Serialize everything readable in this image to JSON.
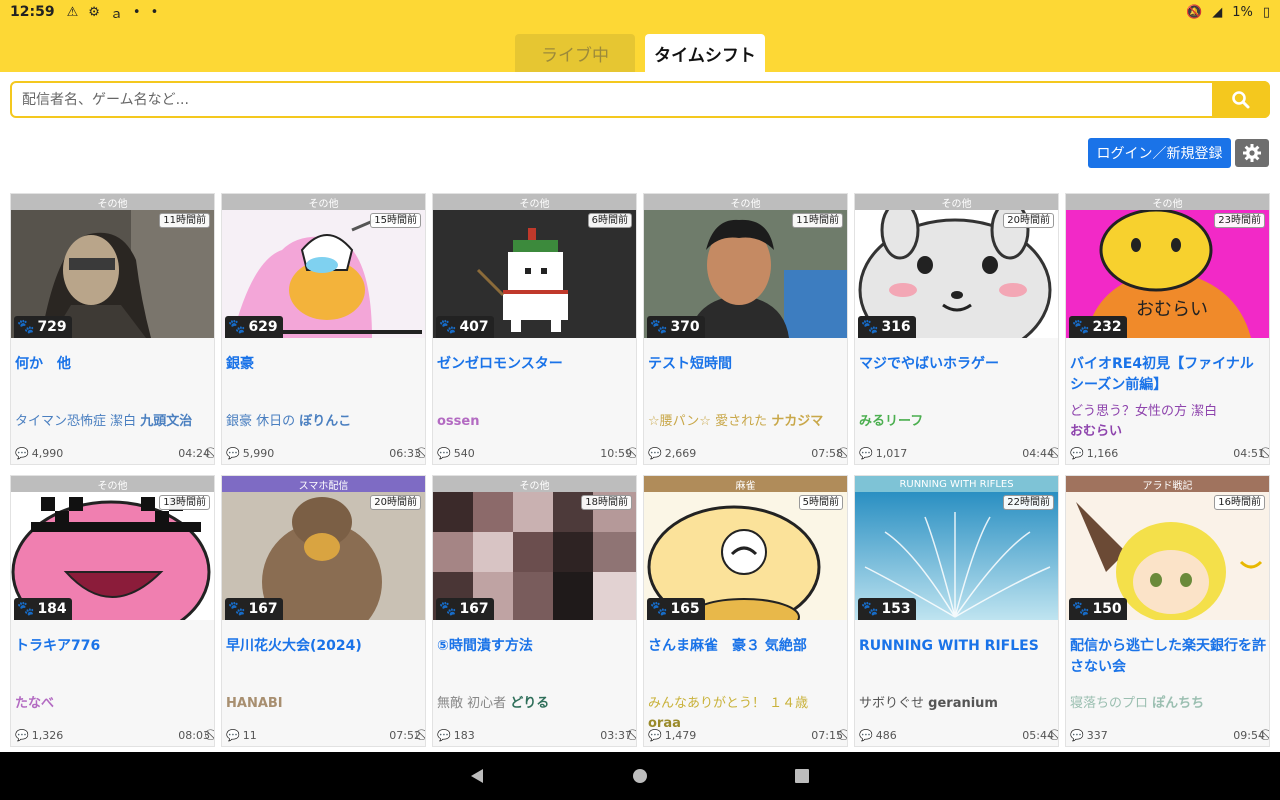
{
  "status": {
    "time": "12:59",
    "battery": "1%"
  },
  "tabs": {
    "live": "ライブ中",
    "timeshift": "タイムシフト"
  },
  "search": {
    "placeholder": "配信者名、ゲーム名など..."
  },
  "login_label": "ログイン／新規登録",
  "cards": [
    {
      "category": "その他",
      "cat_color": "#bdbdbd",
      "ago": "11時間前",
      "viewers": "729",
      "title": "何か　他",
      "sub": "タイマン恐怖症 潔白",
      "author": "九頭文治",
      "sub_color": "#4a7fc0",
      "comments": "4,990",
      "duration": "04:24"
    },
    {
      "category": "その他",
      "cat_color": "#bdbdbd",
      "ago": "15時間前",
      "viewers": "629",
      "title": "銀豪",
      "sub": "銀豪 休日の",
      "author": "ぼりんこ",
      "sub_color": "#4a7fc0",
      "comments": "5,990",
      "duration": "06:33"
    },
    {
      "category": "その他",
      "cat_color": "#bdbdbd",
      "ago": "6時間前",
      "viewers": "407",
      "title": "ゼンゼロモンスター",
      "sub": "",
      "author": "ossen",
      "sub_color": "#b36bc2",
      "comments": "540",
      "duration": "10:59"
    },
    {
      "category": "その他",
      "cat_color": "#bdbdbd",
      "ago": "11時間前",
      "viewers": "370",
      "title": "テスト短時間",
      "sub": "☆腰パン☆ 愛された",
      "author": "ナカジマ",
      "sub_color": "#c9a84a",
      "comments": "2,669",
      "duration": "07:58"
    },
    {
      "category": "その他",
      "cat_color": "#bdbdbd",
      "ago": "20時間前",
      "viewers": "316",
      "title": "マジでやばいホラゲー",
      "sub": "",
      "author": "みるリーフ",
      "sub_color": "#4caf50",
      "comments": "1,017",
      "duration": "04:44"
    },
    {
      "category": "その他",
      "cat_color": "#bdbdbd",
      "ago": "23時間前",
      "viewers": "232",
      "title": "バイオRE4初見【ファイナルシーズン前編】",
      "sub": "どう思う？女性の方 潔白",
      "author": "おむらい",
      "sub_color": "#8e44ad",
      "comments": "1,166",
      "duration": "04:51"
    },
    {
      "category": "その他",
      "cat_color": "#bdbdbd",
      "ago": "13時間前",
      "viewers": "184",
      "title": "トラキア776",
      "sub": "",
      "author": "たなべ",
      "sub_color": "#b36bc2",
      "comments": "1,326",
      "duration": "08:03"
    },
    {
      "category": "スマホ配信",
      "cat_color": "#7e6bc4",
      "ago": "20時間前",
      "viewers": "167",
      "title": "早川花火大会(2024)",
      "sub": "",
      "author": "HANABI",
      "sub_color": "#a88f70",
      "comments": "11",
      "duration": "07:52"
    },
    {
      "category": "その他",
      "cat_color": "#bdbdbd",
      "ago": "18時間前",
      "viewers": "167",
      "title": "⑤時間潰す方法",
      "sub": "無敵 初心者",
      "author": "どりる",
      "sub_color": "#2f6f5a",
      "comments": "183",
      "duration": "03:37"
    },
    {
      "category": "麻雀",
      "cat_color": "#b08c5a",
      "ago": "5時間前",
      "viewers": "165",
      "title": "さんま麻雀　豪３ 気絶部",
      "sub": "みんなありがとう！ １４歳",
      "author": "oraa",
      "sub_color": "#c9b23a",
      "comments": "1,479",
      "duration": "07:15"
    },
    {
      "category": "RUNNING WITH RIFLES",
      "cat_color": "#7ec3d6",
      "ago": "22時間前",
      "viewers": "153",
      "title": "RUNNING WITH RIFLES",
      "sub": "サボりぐせ",
      "author": "geranium",
      "sub_color": "#555555",
      "comments": "486",
      "duration": "05:44"
    },
    {
      "category": "アラド戦記",
      "cat_color": "#a0735e",
      "ago": "16時間前",
      "viewers": "150",
      "title": "配信から逃亡した楽天銀行を許さない会",
      "sub": "寝落ちのプロ",
      "author": "ぽんちち",
      "sub_color": "#9bbfb1",
      "comments": "337",
      "duration": "09:54"
    }
  ],
  "icons": {
    "search": "search-icon",
    "gear": "gear-icon",
    "viewers": "paw-icon",
    "comments": "comment-icon",
    "duration": "no-sign-icon"
  }
}
